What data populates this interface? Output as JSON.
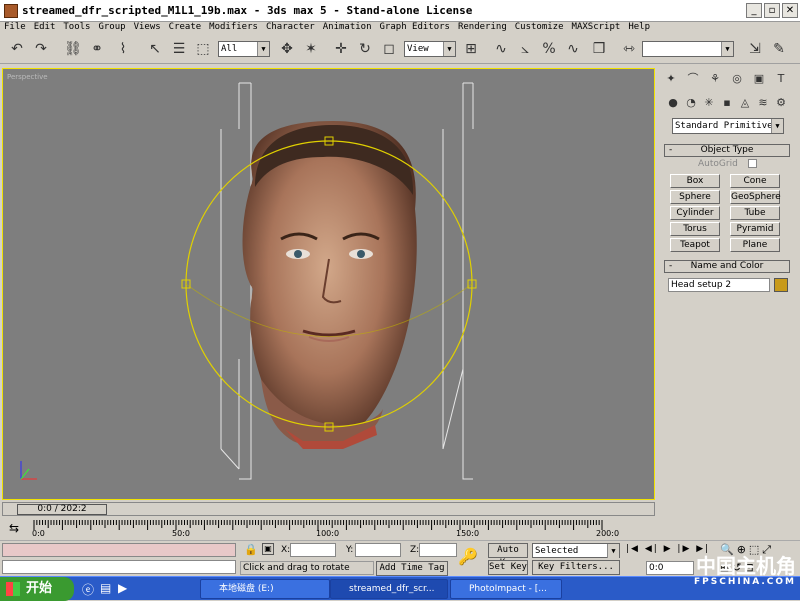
{
  "window": {
    "title": "streamed_dfr_scripted_M1L1_19b.max - 3ds max 5 - Stand-alone License"
  },
  "menu": [
    "File",
    "Edit",
    "Tools",
    "Group",
    "Views",
    "Create",
    "Modifiers",
    "Character",
    "Animation",
    "Graph Editors",
    "Rendering",
    "Customize",
    "MAXScript",
    "Help"
  ],
  "toolbar": {
    "selection_filter": "All",
    "ref_coord": "View"
  },
  "viewport": {
    "label": "Perspective"
  },
  "command_panel": {
    "category": "Standard Primitives",
    "object_type_title": "Object Type",
    "autogrid": "AutoGrid",
    "buttons": [
      "Box",
      "Cone",
      "Sphere",
      "GeoSphere",
      "Cylinder",
      "Tube",
      "Torus",
      "Pyramid",
      "Teapot",
      "Plane"
    ],
    "name_color_title": "Name and Color",
    "object_name": "Head setup 2",
    "object_color": "#c89a1a"
  },
  "timeline": {
    "slider_label": "0:0 / 202:2",
    "ticks": [
      "0:0",
      "50:0",
      "100:0",
      "150:0",
      "200:0"
    ]
  },
  "status": {
    "x_label": "X:",
    "y_label": "Y:",
    "z_label": "Z:",
    "prompt": "Click and drag to rotate",
    "add_time_tag": "Add Time Tag",
    "auto_key": "Auto Key",
    "set_key": "Set Key",
    "key_mode": "Selected",
    "key_filters": "Key Filters...",
    "current_frame": "0:0"
  },
  "taskbar": {
    "start": "开始",
    "tasks": [
      "本地磁盘 (E:)",
      "streamed_dfr_scr...",
      "PhotoImpact - [..."
    ]
  },
  "watermark": {
    "main": "中国主机角",
    "sub": "FPSCHINA.COM"
  }
}
